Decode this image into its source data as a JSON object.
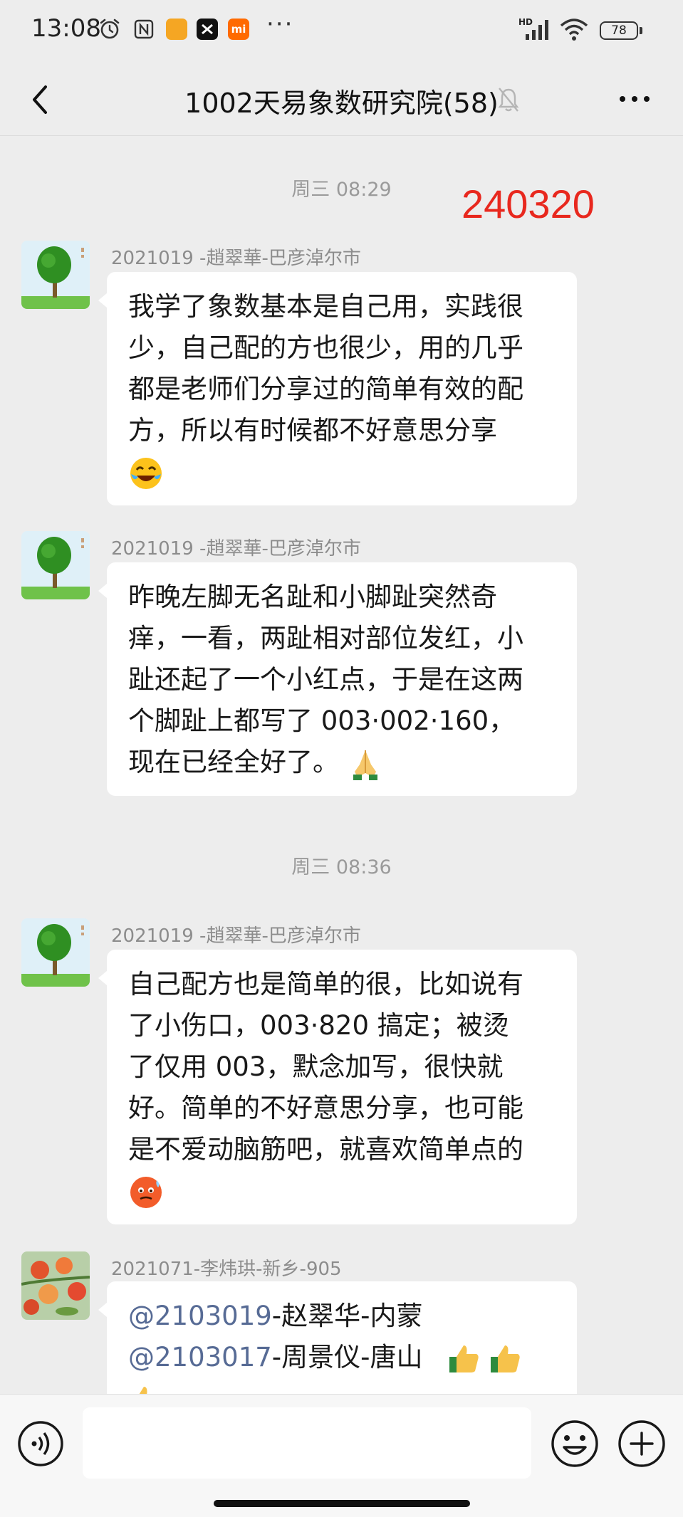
{
  "status_bar": {
    "time": "13:08",
    "icons": [
      "alarm-icon",
      "nfc-icon",
      "app-icon",
      "capcut-icon",
      "mi-icon",
      "more-dots-icon",
      "hd-icon",
      "signal-icon",
      "wifi-icon",
      "battery-icon"
    ],
    "mi_label": "mi",
    "dots": "···",
    "hd": "HD",
    "battery": "78"
  },
  "header": {
    "title": "1002天易象数研究院(58)",
    "icons": [
      "back-icon",
      "mute-bell-icon",
      "more-icon"
    ]
  },
  "stamp": "240320",
  "chat": {
    "time_labels": [
      "周三 08:29",
      "周三 08:36"
    ],
    "messages": [
      {
        "sender": "2021019 -趙翠華-巴彦淖尔市",
        "lines": [
          "我学了象数基本是自己用，实践很",
          "少，自己配的方也很少，用的几乎",
          "都是老师们分享过的简单有效的配",
          "方，所以有时候都不好意思分享"
        ],
        "emoji": "crying-laughing-emoji"
      },
      {
        "sender": "2021019 -趙翠華-巴彦淖尔市",
        "lines": [
          "昨晚左脚无名趾和小脚趾突然奇",
          "痒，一看，两趾相对部位发红，小",
          "趾还起了一个小红点，于是在这两",
          "个脚趾上都写了 003·002·160，",
          "现在已经全好了。"
        ],
        "emoji": "folded-hands-emoji"
      },
      {
        "sender": "2021019 -趙翠華-巴彦淖尔市",
        "lines": [
          "自己配方也是简单的很，比如说有",
          "了小伤口，003·820 搞定；被烫",
          "了仅用 003，默念加写，很快就",
          "好。简单的不好意思分享，也可能",
          "是不爱动脑筋吧，就喜欢简单点的"
        ],
        "emoji": "hot-face-emoji"
      },
      {
        "sender": "2021071-李炜珙-新乡-905",
        "mentions": [
          {
            "at": "@",
            "id": "2103019",
            "rest": "-赵翠华-内蒙"
          },
          {
            "at": "@",
            "id": "2103017",
            "rest": "-周景仪-唐山"
          }
        ],
        "emoji": "thumbs-up-emoji"
      }
    ]
  },
  "input_bar": {
    "icons": [
      "voice-icon",
      "emoji-icon",
      "plus-icon"
    ]
  },
  "colors": {
    "background": "#ededed",
    "bubble": "#ffffff",
    "stamp": "#e8281e",
    "mention": "#576b95",
    "secondary_text": "#9a9a9a"
  }
}
